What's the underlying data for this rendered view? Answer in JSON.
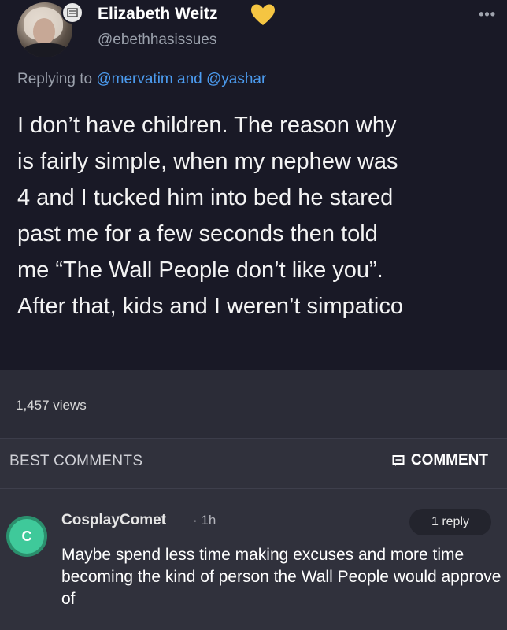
{
  "tweet": {
    "author_name": "Elizabeth Weitz",
    "verified_icon": "yellow-heart-icon",
    "handle": "@ebethhasissues",
    "more_icon": "more-dots-icon",
    "replying_prefix": "Replying to",
    "replying_mention_1": "@mervatim",
    "replying_and": "and",
    "replying_mention_2": "@yashar",
    "text_lines": [
      "I don’t have children. The reason why",
      "is fairly simple, when my nephew was",
      "4 and I tucked him into bed he stared",
      "past me for a few seconds then told",
      "me “The Wall People don’t like you”.",
      "After that, kids and I weren’t simpatico"
    ],
    "views": "1,457 views"
  },
  "comments": {
    "header": "BEST COMMENTS",
    "comment_button": "COMMENT",
    "items": [
      {
        "avatar_letter": "C",
        "author": "CosplayComet",
        "time": "· 1h",
        "replies": "1 reply",
        "text": "Maybe spend less time making excuses and more time becoming the kind of person the Wall People would approve of"
      }
    ]
  },
  "colors": {
    "tweet_bg": "#191926",
    "section_bg": "#30313c",
    "mention": "#4c9cf0",
    "heart": "#f5c542",
    "comment_avatar": "#3fc99a"
  }
}
